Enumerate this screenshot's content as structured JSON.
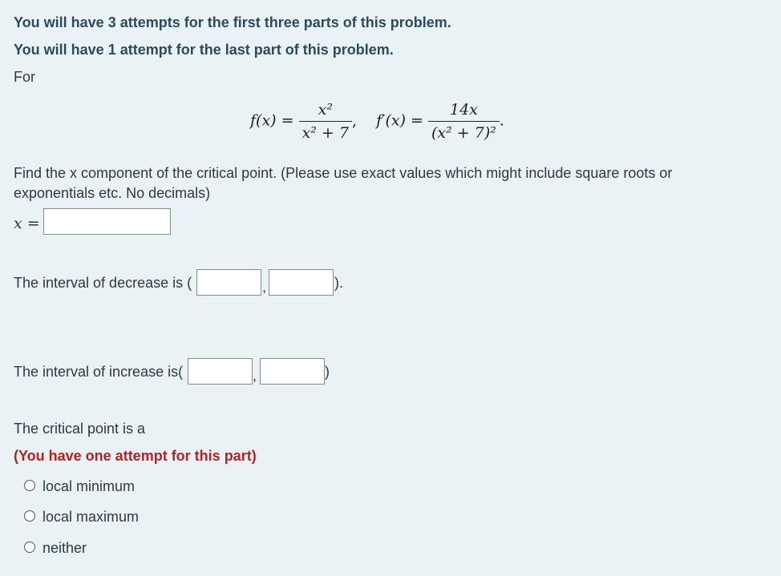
{
  "header": {
    "attempts_line1": "You will have 3 attempts for the first three parts of this problem.",
    "attempts_line2": "You will have 1 attempt for the last part of this problem.",
    "for_label": "For"
  },
  "formula": {
    "f_lhs": "f(x) =",
    "f_num": "x²",
    "f_den": "x² + 7",
    "fprime_lhs": "f′(x) =",
    "fprime_num": "14x",
    "fprime_den": "(x² + 7)²"
  },
  "critical": {
    "prompt": "Find the x component of the critical point. (Please use exact values which might include square roots or exponentials etc. No decimals)",
    "var_label": "x =",
    "answer_value": ""
  },
  "decrease": {
    "label": "The interval of decrease is (",
    "sep": ",",
    "close": ").",
    "left_value": "",
    "right_value": ""
  },
  "increase": {
    "label": "The interval of increase is(",
    "sep": ",",
    "close": ")",
    "left_value": "",
    "right_value": ""
  },
  "classification": {
    "prompt": "The critical point is a",
    "note": "(You have one attempt for this part)",
    "options": [
      "local minimum",
      "local maximum",
      "neither"
    ]
  },
  "colors": {
    "background": "#e9f2f5",
    "heading": "#2d4a5e",
    "note_red": "#b22222"
  }
}
